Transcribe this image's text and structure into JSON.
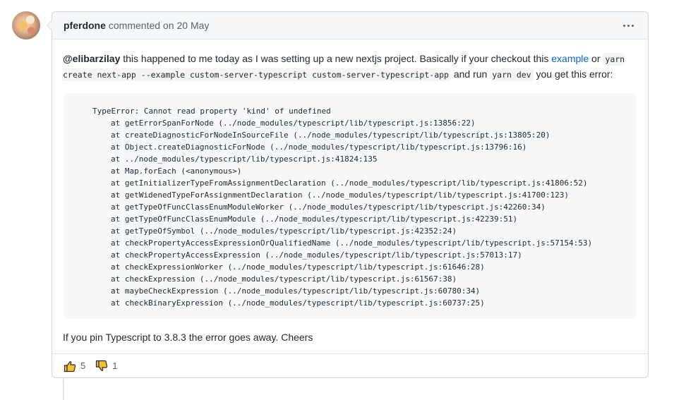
{
  "comment": {
    "author": "pferdone",
    "action": "commented on",
    "timestamp": "20 May",
    "body": {
      "mention": "@elibarzilay",
      "text_1": " this happened to me today as I was setting up a new nextjs project. Basically if your checkout this ",
      "link_text": "example",
      "text_2": " or ",
      "code_inline_1": "yarn create next-app --example custom-server-typescript custom-server-typescript-app",
      "text_3": " and run ",
      "code_inline_2": "yarn dev",
      "text_4": " you get this error:",
      "code_lines": [
        "TypeError: Cannot read property 'kind' of undefined",
        "at getErrorSpanForNode (../node_modules/typescript/lib/typescript.js:13856:22)",
        "at createDiagnosticForNodeInSourceFile (../node_modules/typescript/lib/typescript.js:13805:20)",
        "at Object.createDiagnosticForNode (../node_modules/typescript/lib/typescript.js:13796:16)",
        "at ../node_modules/typescript/lib/typescript.js:41824:135",
        "at Map.forEach (<anonymous>)",
        "at getInitializerTypeFromAssignmentDeclaration (../node_modules/typescript/lib/typescript.js:41806:52)",
        "at getWidenedTypeForAssignmentDeclaration (../node_modules/typescript/lib/typescript.js:41700:123)",
        "at getTypeOfFuncClassEnumModuleWorker (../node_modules/typescript/lib/typescript.js:42260:34)",
        "at getTypeOfFuncClassEnumModule (../node_modules/typescript/lib/typescript.js:42239:51)",
        "at getTypeOfSymbol (../node_modules/typescript/lib/typescript.js:42352:24)",
        "at checkPropertyAccessExpressionOrQualifiedName (../node_modules/typescript/lib/typescript.js:57154:53)",
        "at checkPropertyAccessExpression (../node_modules/typescript/lib/typescript.js:57013:17)",
        "at checkExpressionWorker (../node_modules/typescript/lib/typescript.js:61646:28)",
        "at checkExpression (../node_modules/typescript/lib/typescript.js:61567:38)",
        "at maybeCheckExpression (../node_modules/typescript/lib/typescript.js:60780:34)",
        "at checkBinaryExpression (../node_modules/typescript/lib/typescript.js:60737:25)"
      ],
      "closing": "If you pin Typescript to 3.8.3 the error goes away. Cheers"
    },
    "reactions": [
      {
        "icon": "thumbs-up-icon",
        "count": "5"
      },
      {
        "icon": "thumbs-down-icon",
        "count": "1"
      }
    ]
  },
  "colors": {
    "link": "#0366d6",
    "reaction_fill": "#f6c03b",
    "reaction_stroke": "#2e2a24"
  }
}
